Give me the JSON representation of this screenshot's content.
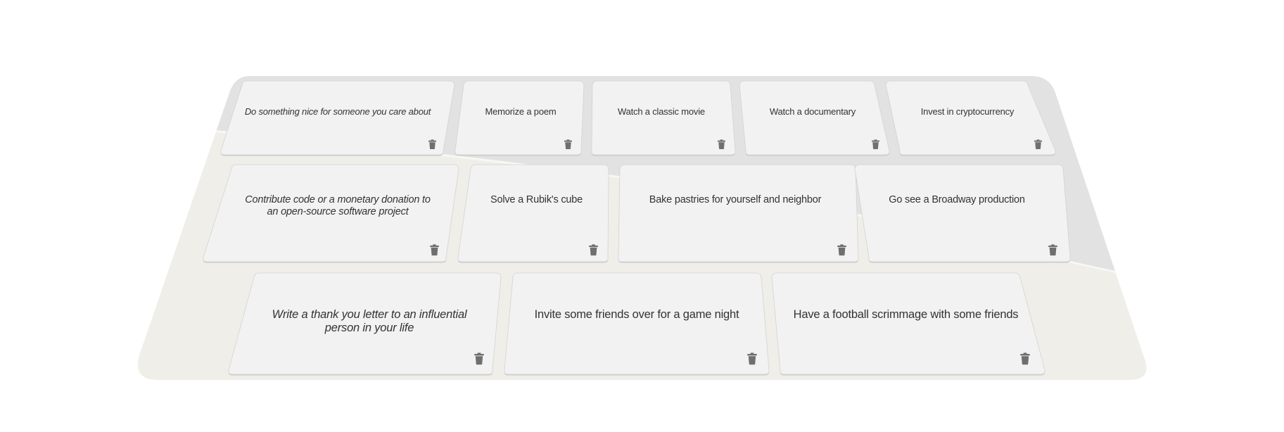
{
  "board": {
    "colors": {
      "surface": "#efeee8",
      "surface_shade": "#e2e2e2",
      "card": "#f2f2f2",
      "card_border": "#d3d3d3",
      "text": "#333333",
      "icon": "#6f6f6f"
    }
  },
  "rows": [
    {
      "cards": [
        {
          "label": "Do something nice for someone you care about",
          "italic": true,
          "delete_icon": "trash-icon"
        },
        {
          "label": "Memorize a poem",
          "italic": false,
          "delete_icon": "trash-icon"
        },
        {
          "label": "Watch a classic movie",
          "italic": false,
          "delete_icon": "trash-icon"
        },
        {
          "label": "Watch a documentary",
          "italic": false,
          "delete_icon": "trash-icon"
        },
        {
          "label": "Invest in cryptocurrency",
          "italic": false,
          "delete_icon": "trash-icon"
        }
      ]
    },
    {
      "cards": [
        {
          "label": "Contribute code or a monetary donation to an open-source software project",
          "italic": true,
          "delete_icon": "trash-icon"
        },
        {
          "label": "Solve a Rubik's cube",
          "italic": false,
          "delete_icon": "trash-icon"
        },
        {
          "label": "Bake pastries for yourself and neighbor",
          "italic": false,
          "delete_icon": "trash-icon"
        },
        {
          "label": "Go see a Broadway production",
          "italic": false,
          "delete_icon": "trash-icon"
        }
      ]
    },
    {
      "cards": [
        {
          "label": "Write a thank you letter to an influential person in your life",
          "italic": true,
          "delete_icon": "trash-icon"
        },
        {
          "label": "Invite some friends over for a game night",
          "italic": false,
          "delete_icon": "trash-icon"
        },
        {
          "label": "Have a football scrimmage with some friends",
          "italic": false,
          "delete_icon": "trash-icon"
        }
      ]
    }
  ]
}
